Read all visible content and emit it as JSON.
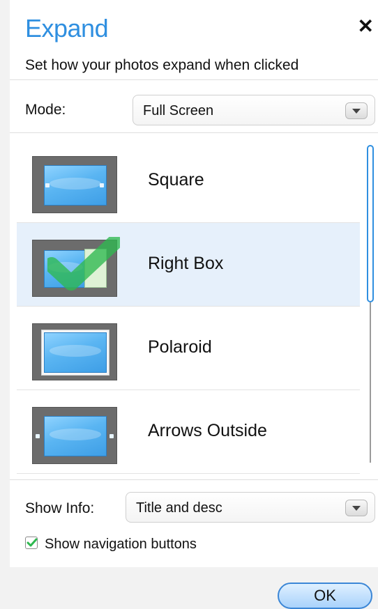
{
  "dialog": {
    "title": "Expand",
    "close_icon": "close-icon",
    "subtitle": "Set how your photos expand when clicked"
  },
  "mode": {
    "label": "Mode:",
    "value": "Full Screen"
  },
  "styles": [
    {
      "label": "Square",
      "selected": false
    },
    {
      "label": "Right Box",
      "selected": true
    },
    {
      "label": "Polaroid",
      "selected": false
    },
    {
      "label": "Arrows Outside",
      "selected": false
    }
  ],
  "show_info": {
    "label": "Show Info:",
    "value": "Title and desc"
  },
  "show_nav": {
    "label": "Show navigation buttons",
    "checked": true
  },
  "ok_label": "OK",
  "colors": {
    "accent": "#2f8fe0",
    "selection": "#e6f0fb",
    "check": "#2eb84f"
  }
}
